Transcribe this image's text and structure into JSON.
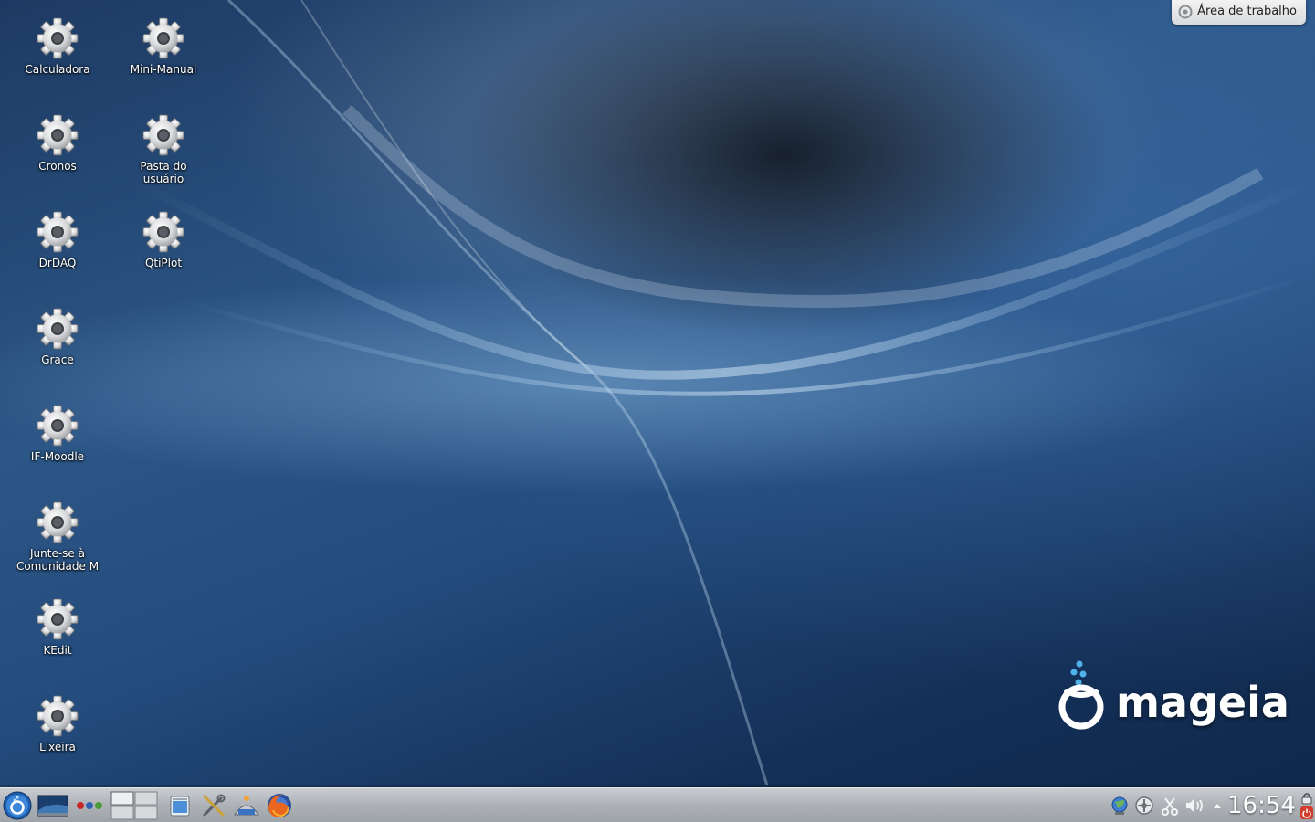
{
  "desktop": {
    "icons": [
      {
        "label": "Calculadora",
        "icon": "gear-icon"
      },
      {
        "label": "Mini-Manual",
        "icon": "gear-icon"
      },
      {
        "label": "Cronos",
        "icon": "gear-icon"
      },
      {
        "label": "Pasta do usuário",
        "icon": "gear-icon"
      },
      {
        "label": "DrDAQ",
        "icon": "gear-icon"
      },
      {
        "label": "QtiPlot",
        "icon": "gear-icon"
      },
      {
        "label": "Grace",
        "icon": "gear-icon"
      },
      {
        "label": "IF-Moodle",
        "icon": "gear-icon"
      },
      {
        "label": "Junte-se à Comunidade M",
        "icon": "gear-icon"
      },
      {
        "label": "KEdit",
        "icon": "gear-icon"
      },
      {
        "label": "Lixeira",
        "icon": "gear-icon"
      }
    ],
    "toolbox_label": "Área de trabalho",
    "logo_text": "mageia"
  },
  "taskbar": {
    "launchers": [
      "kickoff-menu-icon",
      "show-desktop-icon",
      "activity-dots-icon",
      "pager-icon",
      "file-manager-icon",
      "system-settings-icon",
      "software-installer-icon",
      "firefox-icon"
    ],
    "tray_icons": [
      "network-globe-icon",
      "device-notifier-icon",
      "klipper-scissors-icon",
      "volume-icon",
      "expand-arrow-icon"
    ],
    "clock": "16:54",
    "colors": {
      "panel": "#b0b4b9",
      "accent": "#2a6bbd"
    }
  }
}
